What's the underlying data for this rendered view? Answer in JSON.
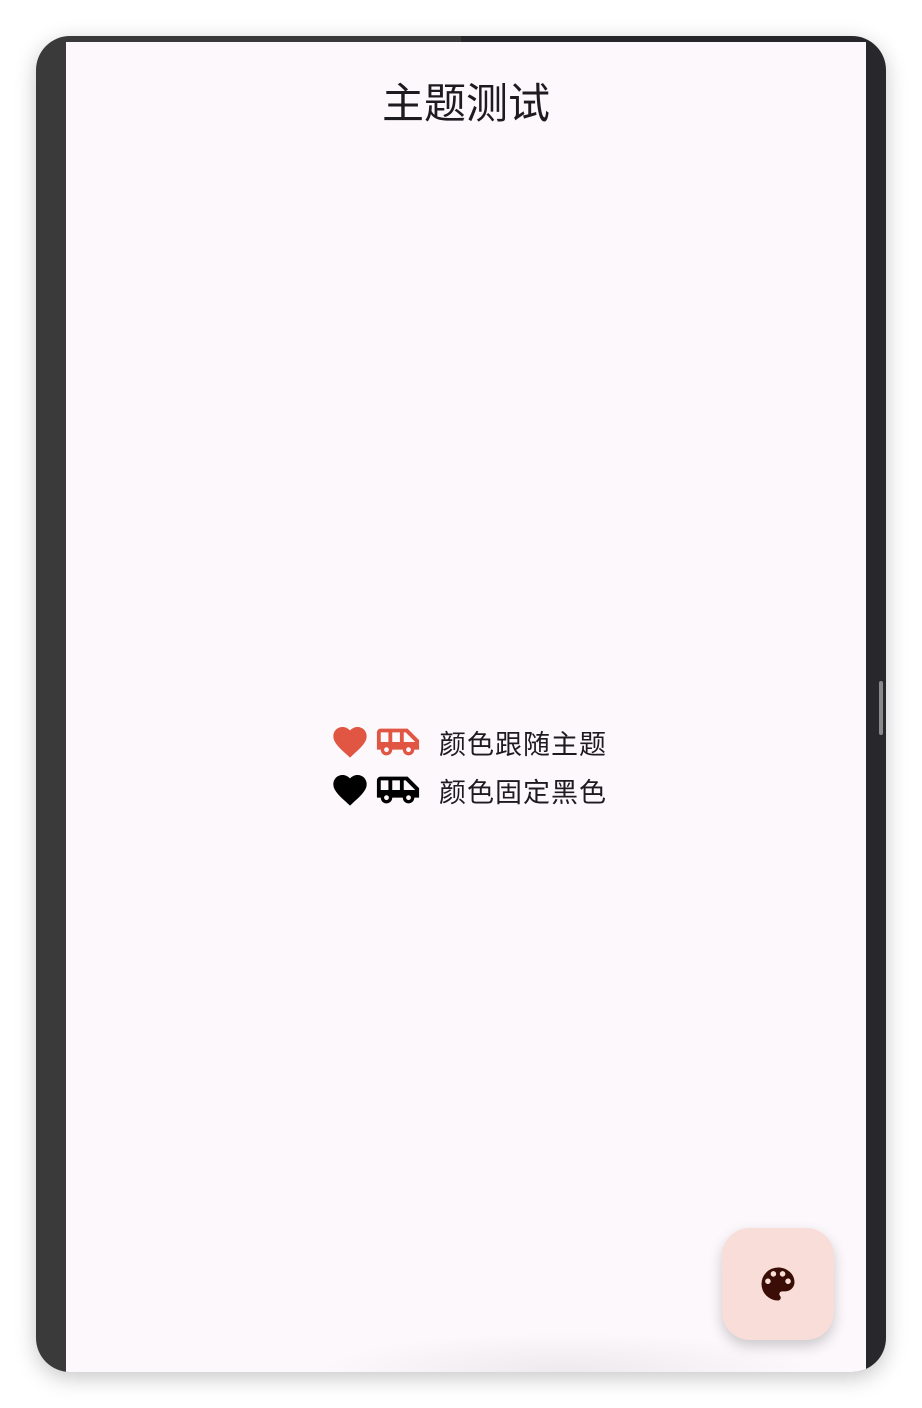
{
  "app": {
    "title": "主题测试"
  },
  "rows": [
    {
      "label": "颜色跟随主题",
      "heart_icon": "favorite-icon",
      "van_icon": "airport-shuttle-icon",
      "icon_color": "#e05643"
    },
    {
      "label": "颜色固定黑色",
      "heart_icon": "favorite-icon",
      "van_icon": "airport-shuttle-icon",
      "icon_color": "#000000"
    }
  ],
  "fab": {
    "icon": "palette-icon",
    "background": "#f8ddd8",
    "icon_color": "#3a0d07"
  },
  "colors": {
    "screen_background": "#fcf8fc",
    "text": "#1d1b20"
  }
}
